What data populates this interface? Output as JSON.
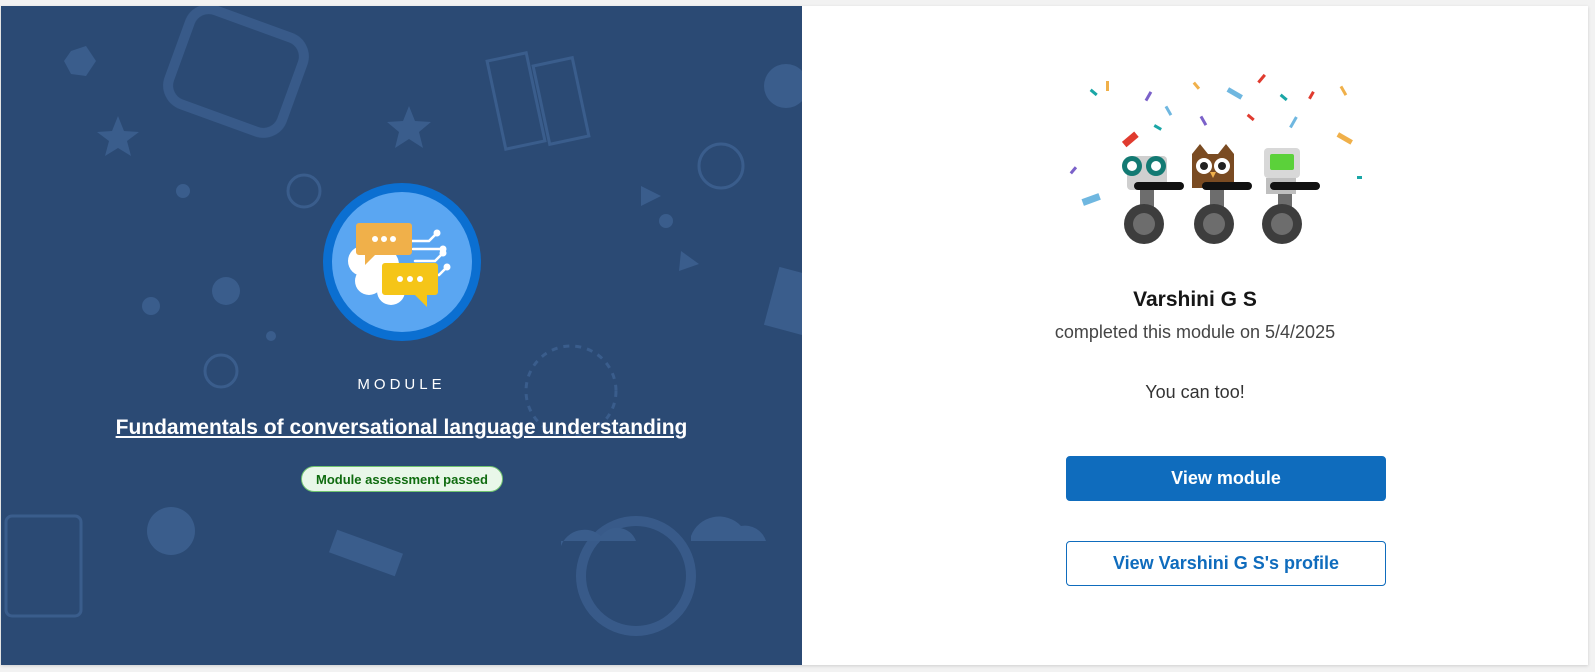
{
  "module": {
    "badge_icon": "chat-bubbles-brain-icon",
    "eyebrow": "MODULE",
    "title": "Fundamentals of conversational language understanding",
    "status": "Module assessment passed"
  },
  "profile": {
    "illustration": "celebrating-mascots-illustration",
    "name": "Varshini G S",
    "completed_text": "completed this module on 5/4/2025",
    "cta_text": "You can too!",
    "view_module_label": "View module",
    "view_profile_label": "View Varshini G S's profile"
  },
  "colors": {
    "left_panel": "#2b4a74",
    "primary_button": "#0f6cbd",
    "status_green": "#0f6b0f"
  }
}
